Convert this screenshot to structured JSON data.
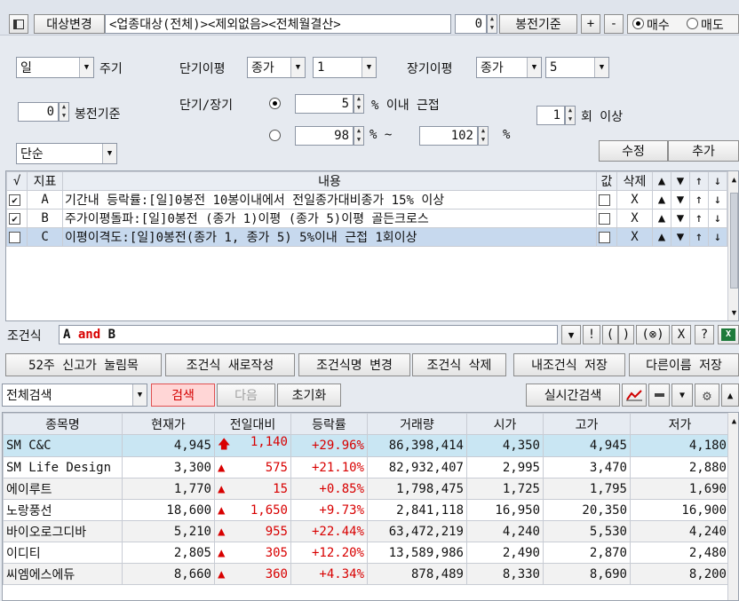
{
  "top": {
    "change_target_label": "대상변경",
    "target_desc": "<업종대상(전체)><제외없음><전체월결산>",
    "offset_value": "0",
    "offset_label": "봉전기준",
    "plus_label": "+",
    "minus_label": "-",
    "buy_label": "매수",
    "sell_label": "매도"
  },
  "settings": {
    "period_value": "일",
    "period_label": "주기",
    "bar_offset_value": "0",
    "bar_offset_label": "봉전기준",
    "mode_value": "단순",
    "short_ma_label": "단기이평",
    "short_ma_price": "종가",
    "short_ma_period": "1",
    "long_ma_label": "장기이평",
    "long_ma_price": "종가",
    "long_ma_period": "5",
    "short_long_label": "단기/장기",
    "within_pct": "5",
    "within_label": "% 이내 근접",
    "range_from": "98",
    "range_to": "102",
    "pct_sym": "%",
    "tilde": "% ~",
    "count_value": "1",
    "count_label": "회 이상",
    "edit_label": "수정",
    "add_label": "추가"
  },
  "conditions": {
    "headers": [
      "√",
      "지표",
      "내용",
      "값",
      "삭제",
      "▲",
      "▼",
      "↑",
      "↓"
    ],
    "rows": [
      {
        "checked": "✔",
        "key": "A",
        "content": "기간내 등락률:[일]0봉전 10봉이내에서 전일종가대비종가 15% 이상",
        "del": "X"
      },
      {
        "checked": "✔",
        "key": "B",
        "content": "주가이평돌파:[일]0봉전 (종가 1)이평 (종가 5)이평 골든크로스",
        "del": "X"
      },
      {
        "checked": "",
        "key": "C",
        "content": "이평이격도:[일]0봉전(종가 1, 종가 5) 5%이내 근접 1회이상",
        "del": "X"
      }
    ]
  },
  "formula": {
    "label": "조건식",
    "parts": [
      "A",
      "and",
      "B"
    ],
    "tools": [
      "▼",
      "!",
      "(",
      ")",
      "(⊗)",
      "X",
      "?"
    ]
  },
  "actions": {
    "preset": "52주 신고가 눌림목",
    "new": "조건식 새로작성",
    "rename": "조건식명 변경",
    "delete": "조건식 삭제",
    "save": "내조건식 저장",
    "save_as": "다른이름 저장"
  },
  "search": {
    "scope": "전체검색",
    "search_label": "검색",
    "next_label": "다음",
    "reset_label": "초기화",
    "realtime_label": "실시간검색"
  },
  "results": {
    "headers": [
      "종목명",
      "현재가",
      "전일대비",
      "등락률",
      "거래량",
      "시가",
      "고가",
      "저가"
    ],
    "rows": [
      {
        "name": "SM C&C",
        "price": "4,945",
        "arrow": "🡅",
        "change": "1,140",
        "rate": "+29.96%",
        "volume": "86,398,414",
        "open": "4,350",
        "high": "4,945",
        "low": "4,180"
      },
      {
        "name": "SM Life Design",
        "price": "3,300",
        "arrow": "▲",
        "change": "575",
        "rate": "+21.10%",
        "volume": "82,932,407",
        "open": "2,995",
        "high": "3,470",
        "low": "2,880"
      },
      {
        "name": "에이루트",
        "price": "1,770",
        "arrow": "▲",
        "change": "15",
        "rate": "+0.85%",
        "volume": "1,798,475",
        "open": "1,725",
        "high": "1,795",
        "low": "1,690"
      },
      {
        "name": "노랑풍선",
        "price": "18,600",
        "arrow": "▲",
        "change": "1,650",
        "rate": "+9.73%",
        "volume": "2,841,118",
        "open": "16,950",
        "high": "20,350",
        "low": "16,900"
      },
      {
        "name": "바이오로그디바",
        "price": "5,210",
        "arrow": "▲",
        "change": "955",
        "rate": "+22.44%",
        "volume": "63,472,219",
        "open": "4,240",
        "high": "5,530",
        "low": "4,240"
      },
      {
        "name": "이디티",
        "price": "2,805",
        "arrow": "▲",
        "change": "305",
        "rate": "+12.20%",
        "volume": "13,589,986",
        "open": "2,490",
        "high": "2,870",
        "low": "2,480"
      },
      {
        "name": "씨엠에스에듀",
        "price": "8,660",
        "arrow": "▲",
        "change": "360",
        "rate": "+4.34%",
        "volume": "878,489",
        "open": "8,330",
        "high": "8,690",
        "low": "8,200"
      }
    ]
  }
}
